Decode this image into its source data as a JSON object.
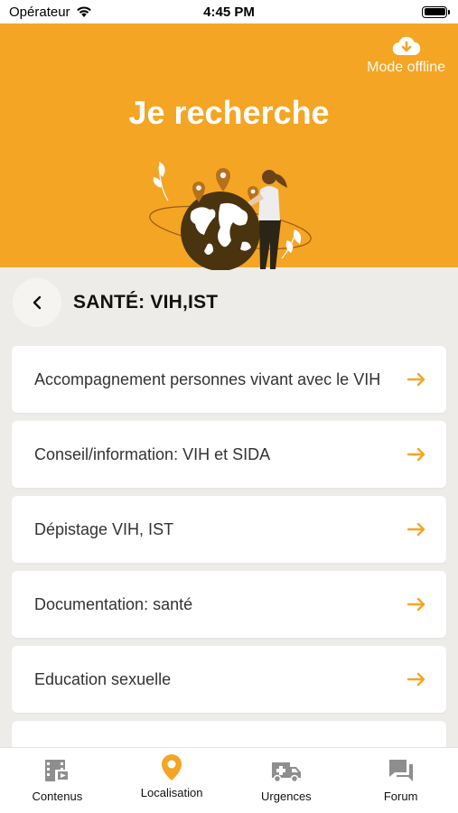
{
  "status_bar": {
    "carrier": "Opérateur",
    "time": "4:45 PM"
  },
  "hero": {
    "title": "Je recherche",
    "offline_label": "Mode offline",
    "accent_color": "#f5a524"
  },
  "section": {
    "title": "SANTÉ: VIH,IST"
  },
  "list_items": [
    {
      "label": "Accompagnement personnes vivant avec le VIH"
    },
    {
      "label": "Conseil/information: VIH et SIDA"
    },
    {
      "label": "Dépistage VIH, IST"
    },
    {
      "label": "Documentation: santé"
    },
    {
      "label": "Education sexuelle"
    }
  ],
  "tabs": [
    {
      "label": "Contenus",
      "icon": "film-icon",
      "active": false
    },
    {
      "label": "Localisation",
      "icon": "map-pin-icon",
      "active": true
    },
    {
      "label": "Urgences",
      "icon": "ambulance-icon",
      "active": false
    },
    {
      "label": "Forum",
      "icon": "chat-icon",
      "active": false
    }
  ]
}
